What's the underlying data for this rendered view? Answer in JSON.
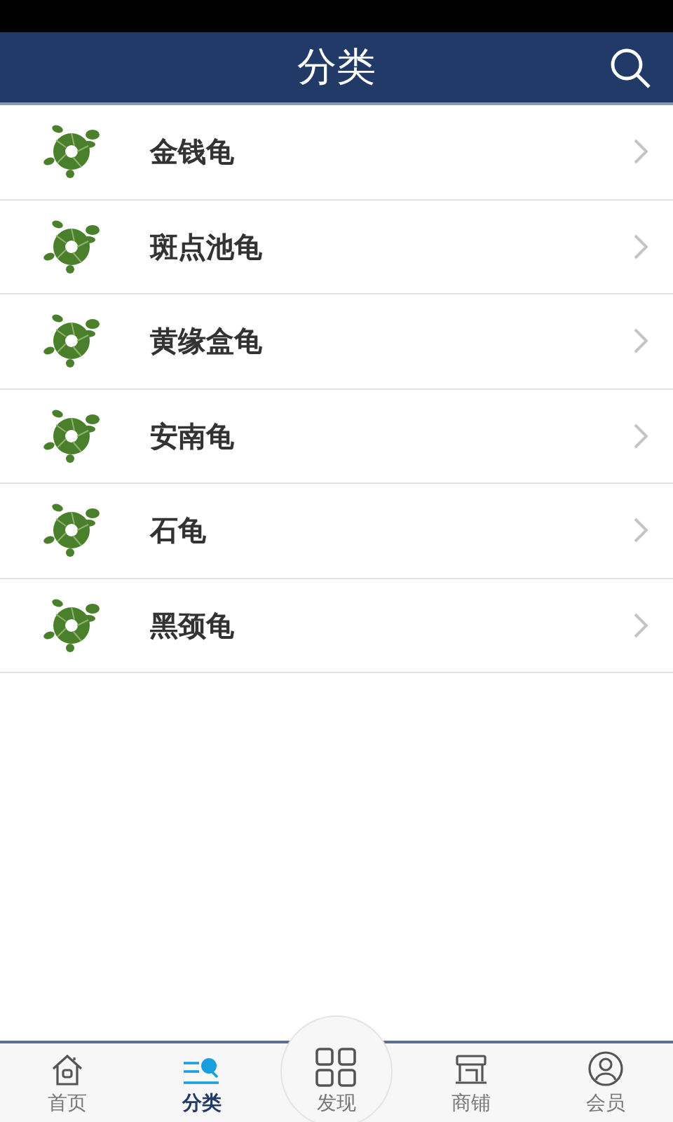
{
  "header": {
    "title": "分类"
  },
  "categories": [
    {
      "name": "金钱龟"
    },
    {
      "name": "斑点池龟"
    },
    {
      "name": "黄缘盒龟"
    },
    {
      "name": "安南龟"
    },
    {
      "name": "石龟"
    },
    {
      "name": "黑颈龟"
    }
  ],
  "tab_bar": [
    {
      "kind": "home",
      "label": "首页",
      "selected": false
    },
    {
      "kind": "category",
      "label": "分类",
      "selected": true
    },
    {
      "kind": "discover",
      "label": "发现",
      "selected": false
    },
    {
      "kind": "shop",
      "label": "商铺",
      "selected": false
    },
    {
      "kind": "member",
      "label": "会员",
      "selected": false
    }
  ]
}
